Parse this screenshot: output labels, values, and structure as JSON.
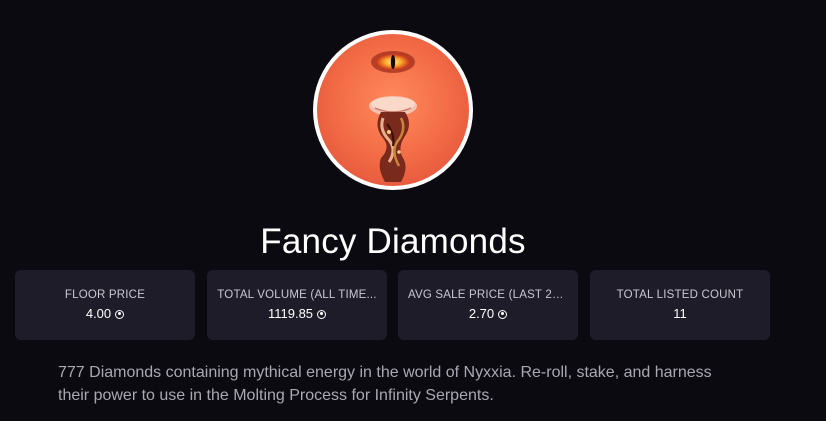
{
  "collection": {
    "name": "Fancy Diamonds",
    "description": "777 Diamonds containing mythical energy in the world of Nyxxia. Re-roll, stake, and harness their power to use in the Molting Process for Infinity Serpents."
  },
  "stats": [
    {
      "label": "FLOOR PRICE",
      "value": "4.00",
      "icon": "currency-icon"
    },
    {
      "label": "TOTAL VOLUME (ALL TIME...",
      "value": "1119.85",
      "icon": "currency-icon"
    },
    {
      "label": "AVG SALE PRICE (LAST 24...",
      "value": "2.70",
      "icon": "currency-icon"
    },
    {
      "label": "TOTAL LISTED COUNT",
      "value": "11"
    }
  ],
  "colors": {
    "background": "#0b0a10",
    "card": "#1d1c28",
    "avatar_bg": "#f26a45"
  }
}
